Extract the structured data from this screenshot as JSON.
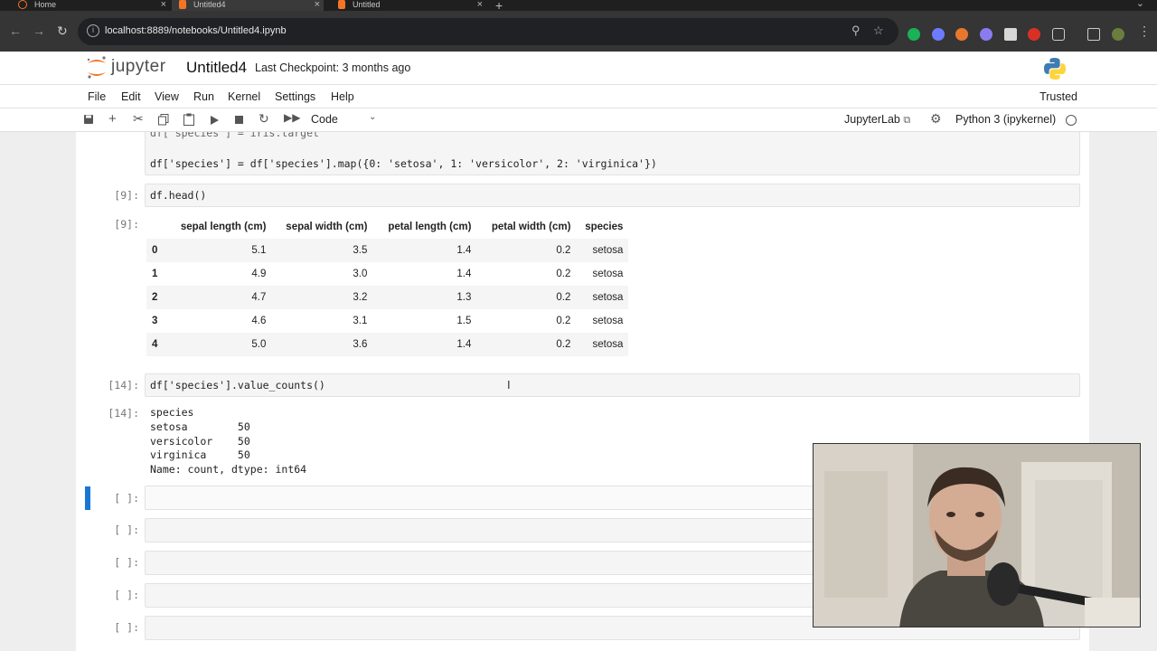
{
  "browser": {
    "tabs": [
      {
        "label": "Home"
      },
      {
        "label": "Untitled4"
      },
      {
        "label": "Untitled"
      }
    ],
    "url": "localhost:8889/notebooks/Untitled4.ipynb"
  },
  "header": {
    "logo_text": "jupyter",
    "notebook_title": "Untitled4",
    "checkpoint": "Last Checkpoint: 3 months ago"
  },
  "menu": {
    "items": [
      "File",
      "Edit",
      "View",
      "Run",
      "Kernel",
      "Settings",
      "Help"
    ],
    "trusted": "Trusted"
  },
  "toolbar": {
    "cell_type": "Code",
    "jupyterlab": "JupyterLab",
    "kernel_name": "Python 3 (ipykernel)"
  },
  "cells": {
    "c0": {
      "code_line2": "df['species'] = df['species'].map({0: 'setosa', 1: 'versicolor', 2: 'virginica'})"
    },
    "c1": {
      "in_prompt": "[9]:",
      "code": "df.head()",
      "out_prompt": "[9]:"
    },
    "c2": {
      "in_prompt": "[14]:",
      "code": "df['species'].value_counts()",
      "out_prompt": "[14]:",
      "output": "species\nsetosa        50\nversicolor    50\nvirginica     50\nName: count, dtype: int64"
    },
    "empty_prompt": "[ ]:"
  },
  "dataframe": {
    "columns": [
      "",
      "sepal length (cm)",
      "sepal width (cm)",
      "petal length (cm)",
      "petal width (cm)",
      "species"
    ],
    "rows": [
      [
        "0",
        "5.1",
        "3.5",
        "1.4",
        "0.2",
        "setosa"
      ],
      [
        "1",
        "4.9",
        "3.0",
        "1.4",
        "0.2",
        "setosa"
      ],
      [
        "2",
        "4.7",
        "3.2",
        "1.3",
        "0.2",
        "setosa"
      ],
      [
        "3",
        "4.6",
        "3.1",
        "1.5",
        "0.2",
        "setosa"
      ],
      [
        "4",
        "5.0",
        "3.6",
        "1.4",
        "0.2",
        "setosa"
      ]
    ]
  }
}
